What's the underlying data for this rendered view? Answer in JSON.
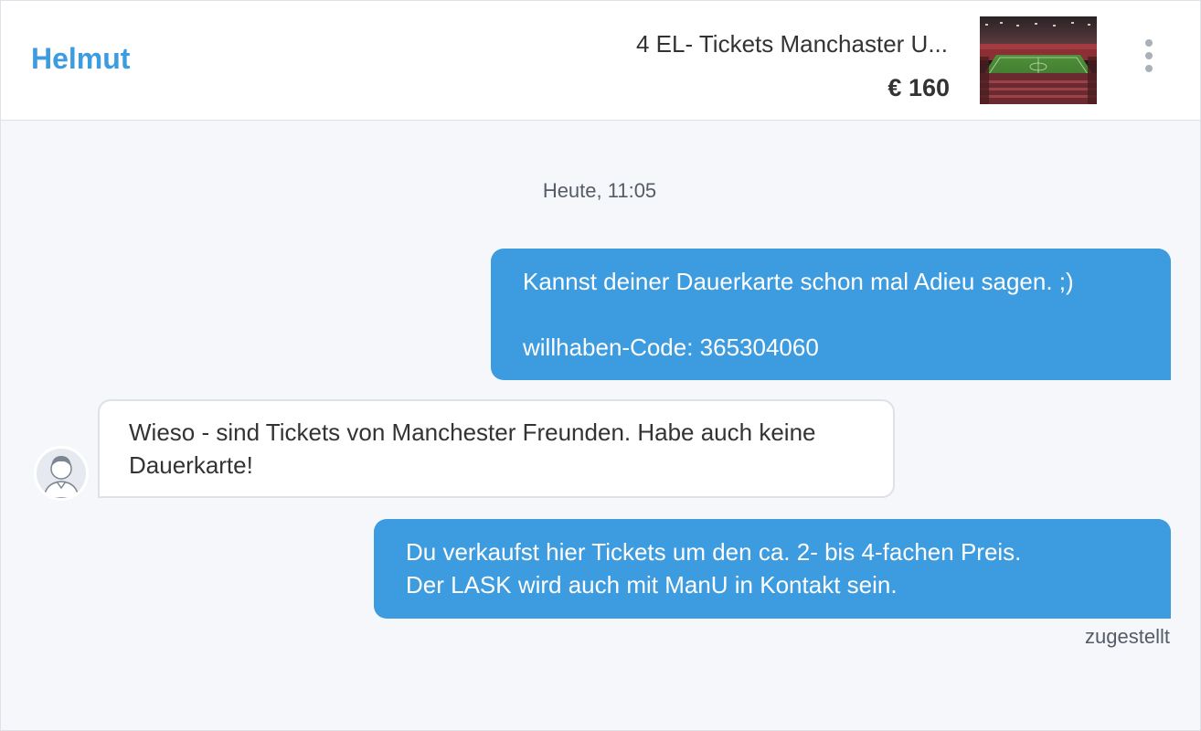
{
  "header": {
    "contact_name": "Helmut",
    "ad_title": "4 EL- Tickets Manchaster U...",
    "ad_price": "€ 160",
    "ad_image_icon": "stadium-photo",
    "more_icon": "more-vertical-icon"
  },
  "chat": {
    "date_separator": "Heute, 11:05",
    "messages": [
      {
        "direction": "outgoing",
        "lines": [
          "Kannst deiner Dauerkarte schon mal Adieu sagen. ;)",
          "",
          "willhaben-Code: 365304060"
        ]
      },
      {
        "direction": "incoming",
        "text": "Wieso - sind Tickets von Manchester Freunden. Habe auch keine Dauerkarte!",
        "avatar_icon": "user-avatar-icon"
      },
      {
        "direction": "outgoing",
        "lines": [
          "Du verkaufst hier Tickets um den ca. 2- bis 4-fachen Preis.",
          "Der LASK wird auch mit ManU in Kontakt sein."
        ]
      }
    ],
    "delivery_status": "zugestellt"
  },
  "colors": {
    "accent": "#3d9be0",
    "background": "#f5f7fb",
    "border": "#dde2e8",
    "text": "#333333",
    "muted": "#555c66"
  }
}
